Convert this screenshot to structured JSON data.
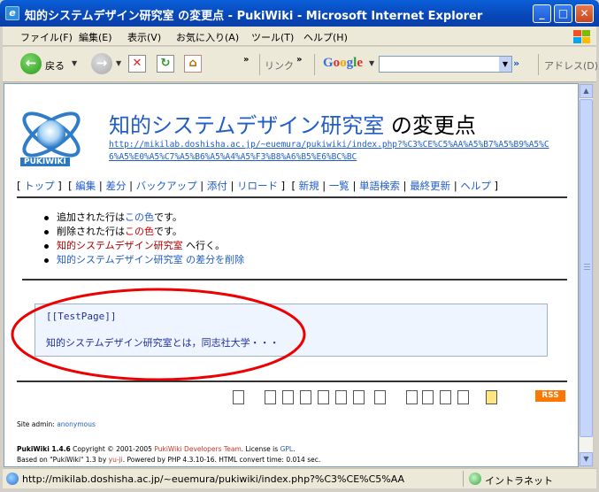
{
  "window": {
    "title": "知的システムデザイン研究室 の変更点 - PukiWiki - Microsoft Internet Explorer",
    "min": "_",
    "max": "□",
    "close": "✕"
  },
  "menu": [
    "ファイル(F)",
    "編集(E)",
    "表示(V)",
    "お気に入り(A)",
    "ツール(T)",
    "ヘルプ(H)"
  ],
  "toolbar": {
    "back": "戻る",
    "more": "»",
    "link": "リンク",
    "google": "Google",
    "address": "アドレス(D)"
  },
  "page": {
    "title_link": "知的システムデザイン研究室",
    "title_rest": " の変更点",
    "url": "http://mikilab.doshisha.ac.jp/~euemura/pukiwiki/index.php?%C3%CE%C5%AA%A5%B7%A5%B9%A5%C6%A5%E0%A5%C7%A5%B6%A5%A4%A5%F3%B8%A6%B5%E6%BC%BC",
    "logo_text": "PUKIWIKI",
    "nav": {
      "top": "トップ",
      "edit": "編集",
      "diff": "差分",
      "backup": "バックアップ",
      "attach": "添付",
      "reload": "リロード",
      "new": "新規",
      "list": "一覧",
      "search": "単語検索",
      "recent": "最終更新",
      "help": "ヘルプ"
    },
    "bullets": {
      "added_prefix": "追加された行は",
      "added_color": "この色",
      "added_suffix": "です。",
      "removed_prefix": "削除された行は",
      "removed_color": "この色",
      "removed_suffix": "です。",
      "goto_link": "知的システムデザイン研究室",
      "goto_suffix": " へ行く。",
      "delete_diff": "知的システムデザイン研究室 の差分を削除"
    },
    "diff": {
      "line1": "[[TestPage]]",
      "line2": "知的システムデザイン研究室とは，同志社大学・・・"
    },
    "rss": "RSS",
    "site_admin_label": "Site admin: ",
    "site_admin": "anonymous",
    "footer1_a": "PukiWiki 1.4.6",
    "footer1_b": " Copyright © 2001-2005 ",
    "footer1_c": "PukiWiki Developers Team",
    "footer1_d": ". License is ",
    "footer1_e": "GPL",
    "footer1_f": ".",
    "footer2_a": "Based on \"PukiWiki\" 1.3 by ",
    "footer2_b": "yu-ji",
    "footer2_c": ". Powered by PHP 4.3.10-16. HTML convert time: 0.014 sec."
  },
  "status": {
    "url": "http://mikilab.doshisha.ac.jp/~euemura/pukiwiki/index.php?%C3%CE%C5%AA",
    "zone": "イントラネット"
  },
  "colors": {
    "link": "#215dc6",
    "added": "#215dc6",
    "removed": "#cc0000",
    "highlight_ellipse": "#ee0000"
  }
}
